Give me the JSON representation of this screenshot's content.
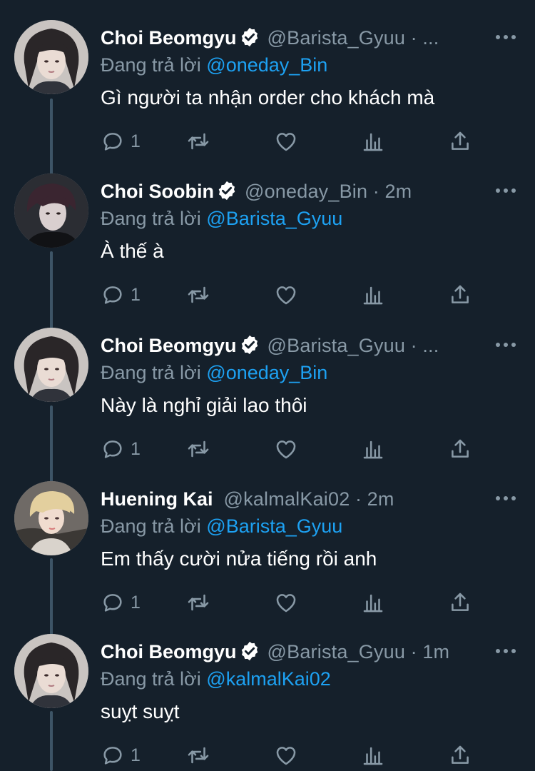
{
  "colors": {
    "background": "#15202b",
    "text": "#ffffff",
    "secondary": "#8899a6",
    "mention": "#1da1f2",
    "thread_line": "#3d5466"
  },
  "icons": {
    "verified": "verified-badge-icon",
    "more": "more-options-icon",
    "reply": "reply-icon",
    "retweet": "retweet-icon",
    "like": "heart-icon",
    "analytics": "analytics-icon",
    "share": "share-icon"
  },
  "tweets": [
    {
      "name": "Choi Beomgyu",
      "verified": true,
      "handle": "@Barista_Gyuu",
      "separator": "·",
      "time": "...",
      "reply_prefix": "Đang trả lời",
      "reply_to": "@oneday_Bin",
      "text": " Gì người ta nhận order cho khách mà",
      "reply_count": "1"
    },
    {
      "name": "Choi Soobin",
      "verified": true,
      "handle": "@oneday_Bin",
      "separator": "·",
      "time": "2m",
      "reply_prefix": "Đang trả lời",
      "reply_to": "@Barista_Gyuu",
      "text": "À thế à",
      "reply_count": "1"
    },
    {
      "name": "Choi Beomgyu",
      "verified": true,
      "handle": "@Barista_Gyuu",
      "separator": "·",
      "time": "...",
      "reply_prefix": "Đang trả lời",
      "reply_to": "@oneday_Bin",
      "text": "Này là nghỉ giải lao thôi",
      "reply_count": "1"
    },
    {
      "name": "Huening Kai",
      "verified": false,
      "handle": "@kalmalKai02",
      "separator": "·",
      "time": "2m",
      "reply_prefix": "Đang trả lời",
      "reply_to": "@Barista_Gyuu",
      "text": "Em thấy cười nửa tiếng rồi anh",
      "reply_count": "1"
    },
    {
      "name": "Choi Beomgyu",
      "verified": true,
      "handle": "@Barista_Gyuu",
      "separator": "·",
      "time": "1m",
      "reply_prefix": "Đang trả lời",
      "reply_to": "@kalmalKai02",
      "text": "suỵt suỵt",
      "reply_count": "1"
    }
  ]
}
